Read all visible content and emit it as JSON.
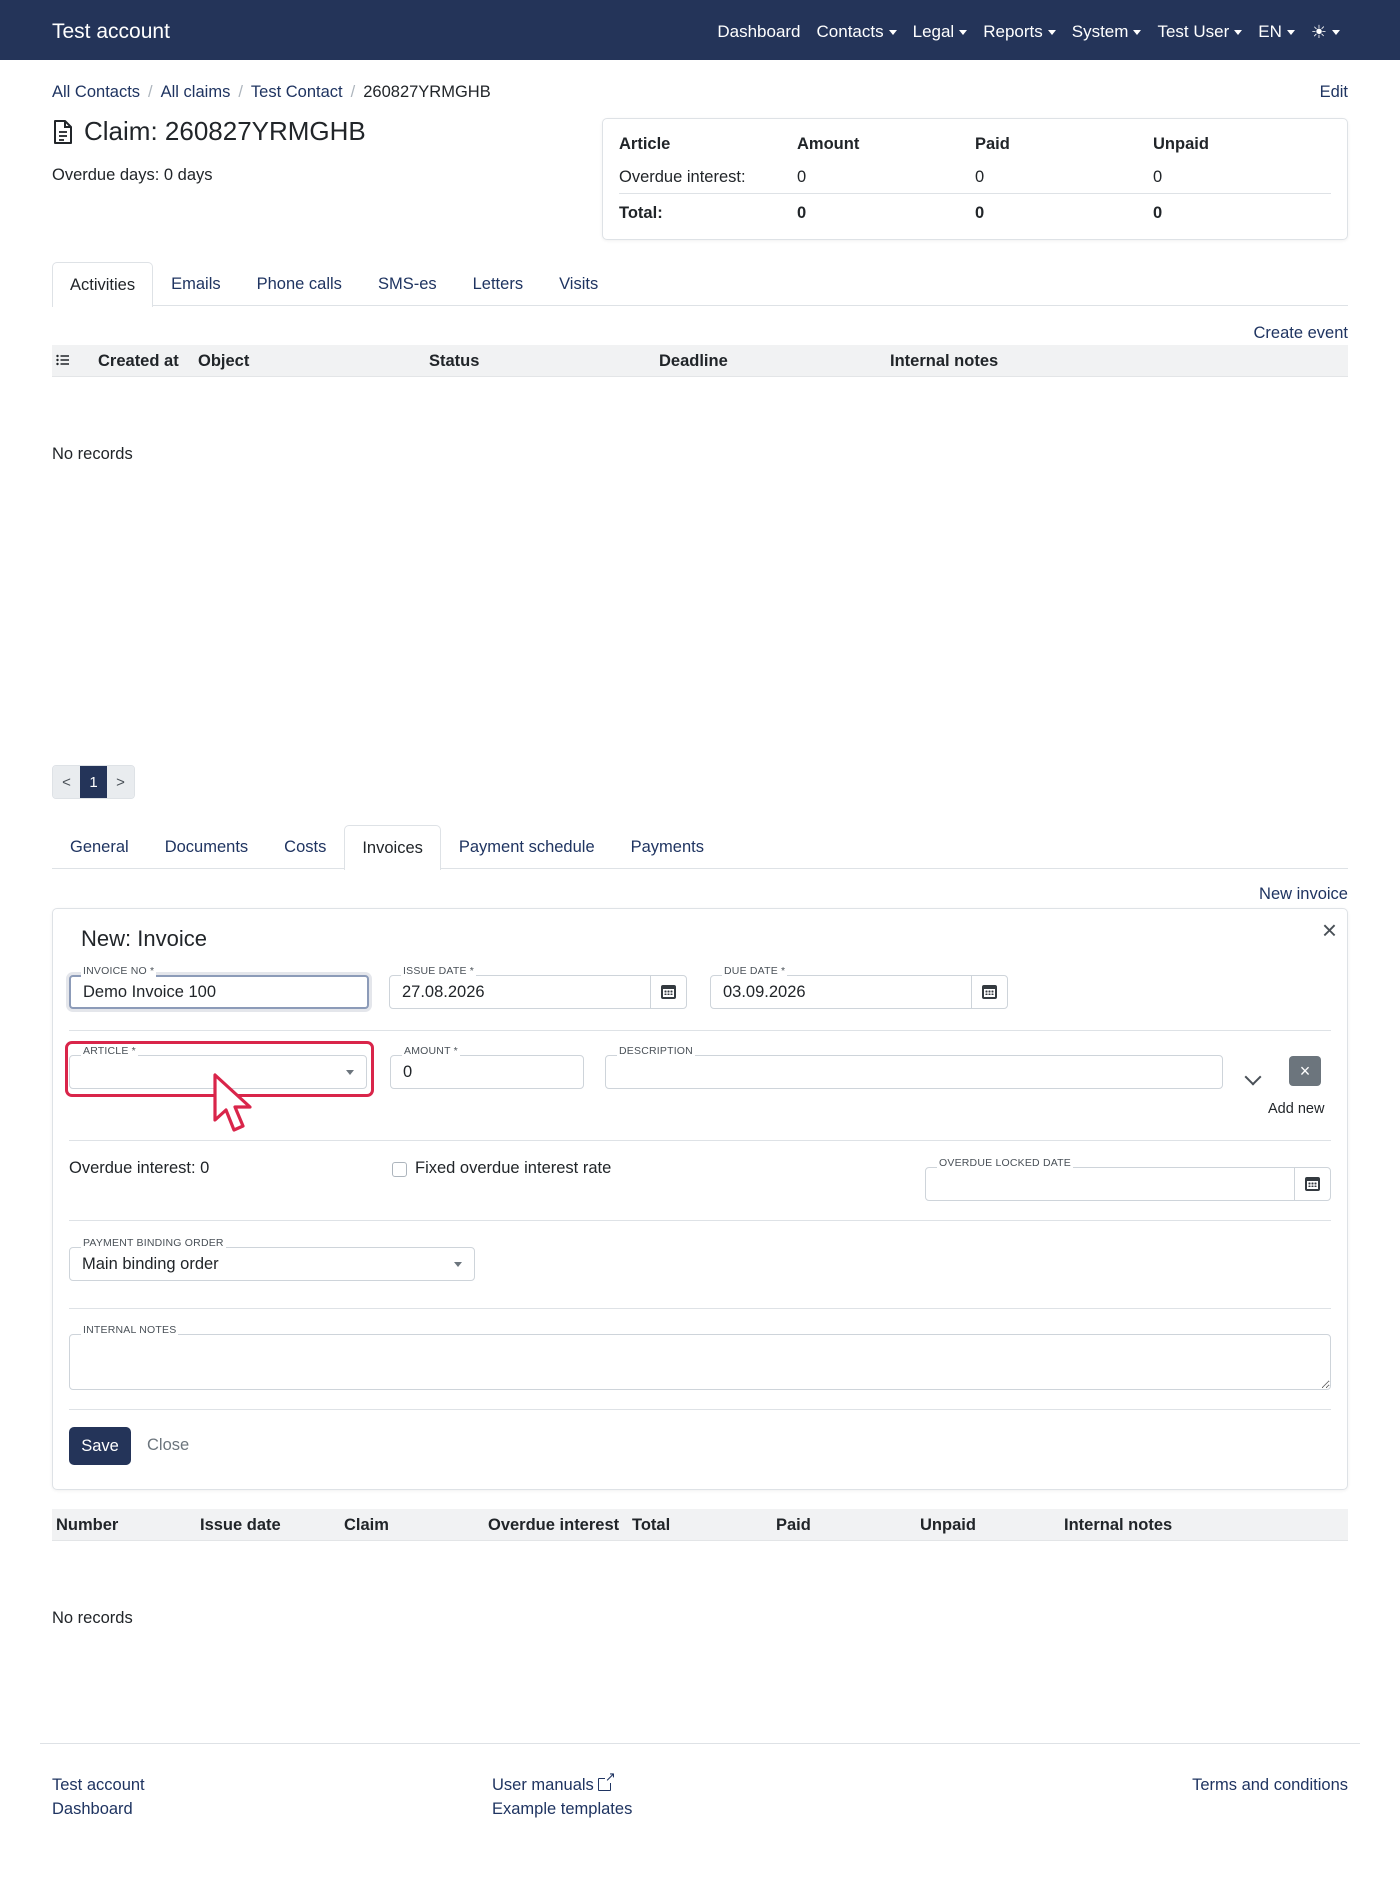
{
  "navbar": {
    "brand": "Test account",
    "items": [
      "Dashboard",
      "Contacts",
      "Legal",
      "Reports",
      "System",
      "Test User",
      "EN"
    ],
    "theme_icon": "☀"
  },
  "breadcrumb": [
    "All Contacts",
    "All claims",
    "Test Contact",
    "260827YRMGHB"
  ],
  "edit_label": "Edit",
  "claim": {
    "title": "Claim: 260827YRMGHB",
    "overdue_days": "Overdue days: 0 days"
  },
  "summary": {
    "headers": [
      "Article",
      "Amount",
      "Paid",
      "Unpaid"
    ],
    "rows": [
      [
        "Overdue interest:",
        "0",
        "0",
        "0"
      ]
    ],
    "total": [
      "Total:",
      "0",
      "0",
      "0"
    ]
  },
  "activity_tabs": [
    "Activities",
    "Emails",
    "Phone calls",
    "SMS-es",
    "Letters",
    "Visits"
  ],
  "create_event_label": "Create event",
  "activity_columns": [
    "Created at",
    "Object",
    "Status",
    "Deadline",
    "Internal notes"
  ],
  "no_records": "No records",
  "pagination": {
    "prev": "<",
    "current": "1",
    "next": ">"
  },
  "claim_tabs": [
    "General",
    "Documents",
    "Costs",
    "Invoices",
    "Payment schedule",
    "Payments"
  ],
  "new_invoice_label": "New invoice",
  "invoice_form": {
    "title": "New: Invoice",
    "close_icon": "×",
    "invoice_no": {
      "label": "INVOICE NO *",
      "value": "Demo Invoice 100"
    },
    "issue_date": {
      "label": "ISSUE DATE *",
      "value": "27.08.2026"
    },
    "due_date": {
      "label": "DUE DATE *",
      "value": "03.09.2026"
    },
    "article": {
      "label": "ARTICLE *",
      "value": ""
    },
    "amount": {
      "label": "AMOUNT *",
      "value": "0"
    },
    "description": {
      "label": "DESCRIPTION",
      "value": ""
    },
    "delete_icon": "×",
    "add_new_label": "Add new",
    "overdue_interest": "Overdue interest: 0",
    "fixed_rate_label": "Fixed overdue interest rate",
    "overdue_locked_date": {
      "label": "OVERDUE LOCKED DATE",
      "value": ""
    },
    "payment_binding_order": {
      "label": "PAYMENT BINDING ORDER",
      "value": "Main binding order"
    },
    "internal_notes": {
      "label": "INTERNAL NOTES",
      "value": ""
    },
    "save_label": "Save",
    "close_label": "Close"
  },
  "invoice_columns": [
    "Number",
    "Issue date",
    "Claim",
    "Overdue interest",
    "Total",
    "Paid",
    "Unpaid",
    "Internal notes"
  ],
  "footer": {
    "left": [
      "Test account",
      "Dashboard"
    ],
    "middle": [
      "User manuals",
      "Example templates"
    ],
    "right": [
      "Terms and conditions"
    ]
  },
  "colors": {
    "navbar": "#243459",
    "link": "#1f3461",
    "highlight": "#d9254a",
    "primary_button": "#243459"
  },
  "icons": [
    "document-icon",
    "calendar-icon",
    "list-icon",
    "chevron-down-icon",
    "close-icon",
    "external-link-icon",
    "sun-icon",
    "cursor-icon"
  ]
}
